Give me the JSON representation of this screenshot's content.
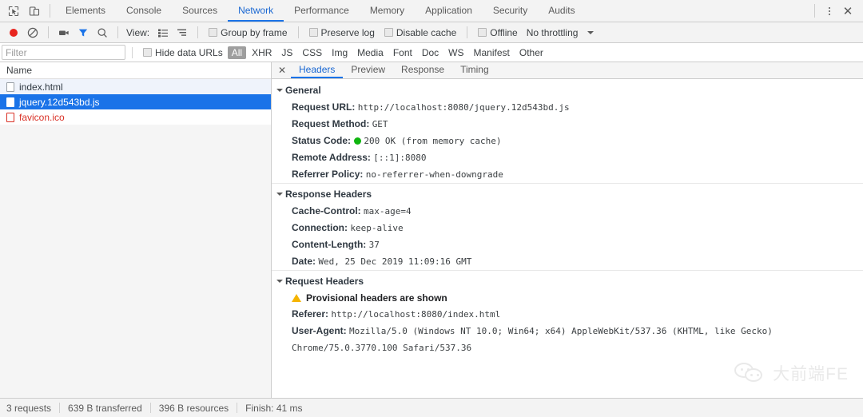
{
  "tabbar": {
    "icons": [
      {
        "name": "inspect-element-icon"
      },
      {
        "name": "device-toolbar-icon"
      }
    ],
    "tabs": [
      {
        "label": "Elements",
        "active": false
      },
      {
        "label": "Console",
        "active": false
      },
      {
        "label": "Sources",
        "active": false
      },
      {
        "label": "Network",
        "active": true
      },
      {
        "label": "Performance",
        "active": false
      },
      {
        "label": "Memory",
        "active": false
      },
      {
        "label": "Application",
        "active": false
      },
      {
        "label": "Security",
        "active": false
      },
      {
        "label": "Audits",
        "active": false
      }
    ],
    "more_icon": "kebab-menu-icon",
    "close_icon": "close-icon"
  },
  "toolbar": {
    "record_icon": "record-button-icon",
    "clear_icon": "clear-icon",
    "capture_screenshots_icon": "camera-icon",
    "filter_icon": "filter-funnel-icon",
    "search_icon": "search-icon",
    "view_label": "View:",
    "view_list_icon": "list-view-icon",
    "view_waterfall_icon": "waterfall-view-icon",
    "checkboxes": [
      {
        "label": "Group by frame",
        "checked": false
      },
      {
        "label": "Preserve log",
        "checked": false
      },
      {
        "label": "Disable cache",
        "checked": false
      },
      {
        "label": "Offline",
        "checked": false
      }
    ],
    "throttling_value": "No throttling",
    "throttling_caret": "chevron-down-icon"
  },
  "filterbar": {
    "placeholder": "Filter",
    "value": "",
    "hide_data_urls_label": "Hide data URLs",
    "hide_data_urls_checked": false,
    "types": [
      {
        "label": "All",
        "active": true
      },
      {
        "label": "XHR",
        "active": false
      },
      {
        "label": "JS",
        "active": false
      },
      {
        "label": "CSS",
        "active": false
      },
      {
        "label": "Img",
        "active": false
      },
      {
        "label": "Media",
        "active": false
      },
      {
        "label": "Font",
        "active": false
      },
      {
        "label": "Doc",
        "active": false
      },
      {
        "label": "WS",
        "active": false
      },
      {
        "label": "Manifest",
        "active": false
      },
      {
        "label": "Other",
        "active": false
      }
    ]
  },
  "request_list": {
    "column_header": "Name",
    "rows": [
      {
        "name": "index.html",
        "state": "alt"
      },
      {
        "name": "jquery.12d543bd.js",
        "state": "selected"
      },
      {
        "name": "favicon.ico",
        "state": "error"
      }
    ]
  },
  "detail": {
    "close_icon": "close-icon",
    "tabs": [
      {
        "label": "Headers",
        "active": true
      },
      {
        "label": "Preview",
        "active": false
      },
      {
        "label": "Response",
        "active": false
      },
      {
        "label": "Timing",
        "active": false
      }
    ],
    "general": {
      "title": "General",
      "request_url_key": "Request URL:",
      "request_url_value": "http://localhost:8080/jquery.12d543bd.js",
      "request_method_key": "Request Method:",
      "request_method_value": "GET",
      "status_code_key": "Status Code:",
      "status_code_value": "200 OK (from memory cache)",
      "status_dot_color": "#0fb50f",
      "remote_address_key": "Remote Address:",
      "remote_address_value": "[::1]:8080",
      "referrer_policy_key": "Referrer Policy:",
      "referrer_policy_value": "no-referrer-when-downgrade"
    },
    "response_headers": {
      "title": "Response Headers",
      "items": [
        {
          "key": "Cache-Control:",
          "value": "max-age=4"
        },
        {
          "key": "Connection:",
          "value": "keep-alive"
        },
        {
          "key": "Content-Length:",
          "value": "37"
        },
        {
          "key": "Date:",
          "value": "Wed, 25 Dec 2019 11:09:16 GMT"
        }
      ]
    },
    "request_headers": {
      "title": "Request Headers",
      "warning_icon": "warning-triangle-icon",
      "warning_text": "Provisional headers are shown",
      "referer_key": "Referer:",
      "referer_value": "http://localhost:8080/index.html",
      "user_agent_key": "User-Agent:",
      "user_agent_value": "Mozilla/5.0 (Windows NT 10.0; Win64; x64) AppleWebKit/537.36 (KHTML, like Gecko) Chrome/75.0.3770.100 Safari/537.36"
    }
  },
  "watermark": {
    "logo_icon": "wechat-logo-icon",
    "text": "大前端FE"
  },
  "statusbar": {
    "requests": "3 requests",
    "transferred": "639 B transferred",
    "resources": "396 B resources",
    "finish": "Finish: 41 ms"
  }
}
